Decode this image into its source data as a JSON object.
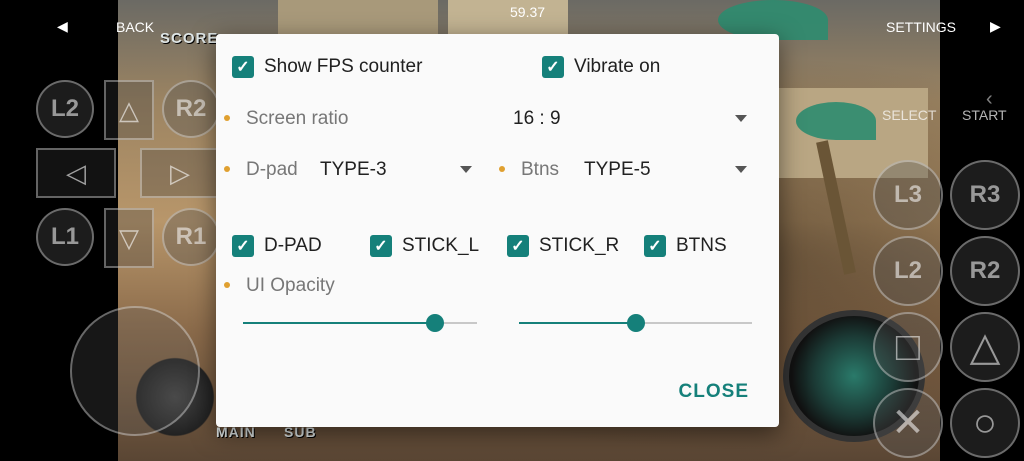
{
  "topbar": {
    "back_label": "BACK",
    "fps": "59.37",
    "settings_label": "SETTINGS"
  },
  "game_hud": {
    "score_label": "SCORE",
    "main_label": "MAIN",
    "sub_label": "SUB"
  },
  "overlay": {
    "left_top": "L2",
    "left_bottom": "L1",
    "right_top_inner": "R2",
    "right_bottom_inner": "R1",
    "l3": "L3",
    "r3": "R3",
    "l2_right": "L2",
    "r2_right": "R2",
    "select_label": "SELECT",
    "start_label": "START",
    "dpad_up": "△",
    "dpad_down": "▽",
    "dpad_left": "◁",
    "dpad_right": "▷",
    "triangle": "△",
    "square": "□",
    "cross": "✕",
    "circle": "○"
  },
  "dialog": {
    "show_fps": {
      "label": "Show FPS counter",
      "checked": true
    },
    "vibrate": {
      "label": "Vibrate on",
      "checked": true
    },
    "screen_ratio": {
      "label": "Screen ratio",
      "value": "16 : 9"
    },
    "dpad": {
      "label": "D-pad",
      "value": "TYPE-3"
    },
    "btns": {
      "label": "Btns",
      "value": "TYPE-5"
    },
    "toggles": [
      {
        "label": "D-PAD",
        "checked": true
      },
      {
        "label": "STICK_L",
        "checked": true
      },
      {
        "label": "STICK_R",
        "checked": true
      },
      {
        "label": "BTNS",
        "checked": true
      }
    ],
    "ui_opacity": {
      "label": "UI Opacity",
      "left_value": 0.82,
      "right_value": 0.5
    },
    "close_label": "CLOSE"
  },
  "colors": {
    "accent": "#15807a",
    "bullet": "#e0a030"
  }
}
